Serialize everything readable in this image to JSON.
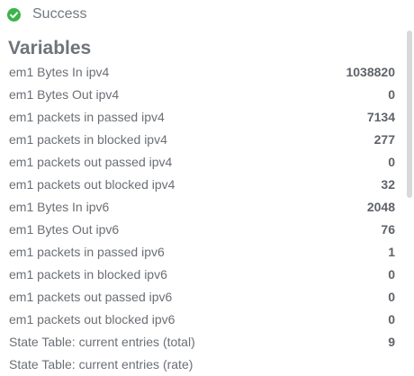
{
  "status": {
    "icon": "check-circle-icon",
    "color": "#3cb34a",
    "text": "Success"
  },
  "variables": {
    "title": "Variables",
    "rows": [
      {
        "name": "em1 Bytes In ipv4",
        "value": "1038820"
      },
      {
        "name": "em1 Bytes Out ipv4",
        "value": "0"
      },
      {
        "name": "em1 packets in passed ipv4",
        "value": "7134"
      },
      {
        "name": "em1 packets in blocked ipv4",
        "value": "277"
      },
      {
        "name": "em1 packets out passed ipv4",
        "value": "0"
      },
      {
        "name": "em1 packets out blocked ipv4",
        "value": "32"
      },
      {
        "name": "em1 Bytes In ipv6",
        "value": "2048"
      },
      {
        "name": "em1 Bytes Out ipv6",
        "value": "76"
      },
      {
        "name": "em1 packets in passed ipv6",
        "value": "1"
      },
      {
        "name": "em1 packets in blocked ipv6",
        "value": "0"
      },
      {
        "name": "em1 packets out passed ipv6",
        "value": "0"
      },
      {
        "name": "em1 packets out blocked ipv6",
        "value": "0"
      },
      {
        "name": "State Table: current entries (total)",
        "value": "9"
      },
      {
        "name": "State Table: current entries (rate)",
        "value": ""
      }
    ]
  }
}
